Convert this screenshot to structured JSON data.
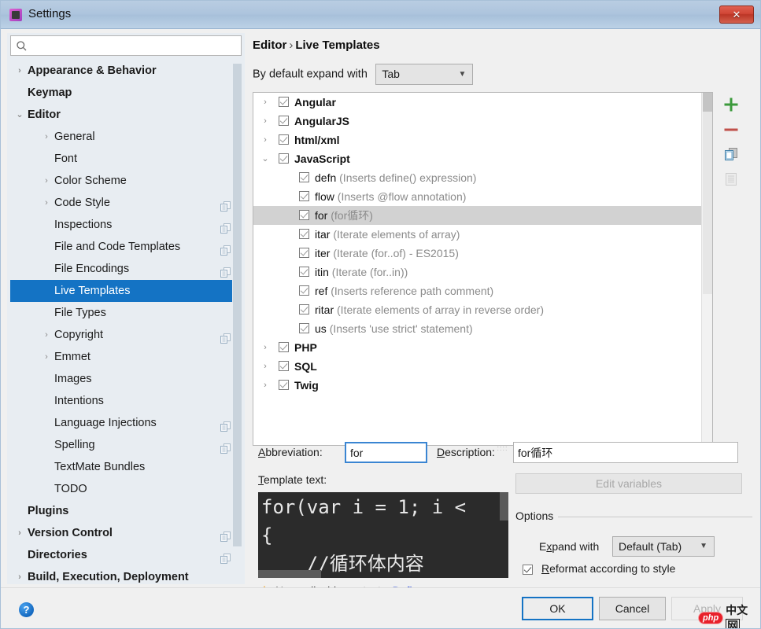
{
  "window": {
    "title": "Settings",
    "app_icon": "jetbrains-icon",
    "close_label": "✕"
  },
  "search": {
    "value": "",
    "placeholder": "",
    "icon": "search-icon"
  },
  "sidebar": {
    "items": [
      {
        "label": "Appearance & Behavior",
        "indent": 0,
        "arrow": "›",
        "bold": true,
        "copy": false,
        "selected": false
      },
      {
        "label": "Keymap",
        "indent": 0,
        "arrow": "",
        "bold": true,
        "copy": false,
        "selected": false
      },
      {
        "label": "Editor",
        "indent": 0,
        "arrow": "⌄",
        "bold": true,
        "copy": false,
        "selected": false
      },
      {
        "label": "General",
        "indent": 1,
        "arrow": "›",
        "bold": false,
        "copy": false,
        "selected": false
      },
      {
        "label": "Font",
        "indent": 1,
        "arrow": "",
        "bold": false,
        "copy": false,
        "selected": false
      },
      {
        "label": "Color Scheme",
        "indent": 1,
        "arrow": "›",
        "bold": false,
        "copy": false,
        "selected": false
      },
      {
        "label": "Code Style",
        "indent": 1,
        "arrow": "›",
        "bold": false,
        "copy": true,
        "selected": false
      },
      {
        "label": "Inspections",
        "indent": 1,
        "arrow": "",
        "bold": false,
        "copy": true,
        "selected": false
      },
      {
        "label": "File and Code Templates",
        "indent": 1,
        "arrow": "",
        "bold": false,
        "copy": true,
        "selected": false
      },
      {
        "label": "File Encodings",
        "indent": 1,
        "arrow": "",
        "bold": false,
        "copy": true,
        "selected": false
      },
      {
        "label": "Live Templates",
        "indent": 1,
        "arrow": "",
        "bold": false,
        "copy": false,
        "selected": true
      },
      {
        "label": "File Types",
        "indent": 1,
        "arrow": "",
        "bold": false,
        "copy": false,
        "selected": false
      },
      {
        "label": "Copyright",
        "indent": 1,
        "arrow": "›",
        "bold": false,
        "copy": true,
        "selected": false
      },
      {
        "label": "Emmet",
        "indent": 1,
        "arrow": "›",
        "bold": false,
        "copy": false,
        "selected": false
      },
      {
        "label": "Images",
        "indent": 1,
        "arrow": "",
        "bold": false,
        "copy": false,
        "selected": false
      },
      {
        "label": "Intentions",
        "indent": 1,
        "arrow": "",
        "bold": false,
        "copy": false,
        "selected": false
      },
      {
        "label": "Language Injections",
        "indent": 1,
        "arrow": "",
        "bold": false,
        "copy": true,
        "selected": false
      },
      {
        "label": "Spelling",
        "indent": 1,
        "arrow": "",
        "bold": false,
        "copy": true,
        "selected": false
      },
      {
        "label": "TextMate Bundles",
        "indent": 1,
        "arrow": "",
        "bold": false,
        "copy": false,
        "selected": false
      },
      {
        "label": "TODO",
        "indent": 1,
        "arrow": "",
        "bold": false,
        "copy": false,
        "selected": false
      },
      {
        "label": "Plugins",
        "indent": 0,
        "arrow": "",
        "bold": true,
        "copy": false,
        "selected": false
      },
      {
        "label": "Version Control",
        "indent": 0,
        "arrow": "›",
        "bold": true,
        "copy": true,
        "selected": false
      },
      {
        "label": "Directories",
        "indent": 0,
        "arrow": "",
        "bold": true,
        "copy": true,
        "selected": false
      },
      {
        "label": "Build, Execution, Deployment",
        "indent": 0,
        "arrow": "›",
        "bold": true,
        "copy": false,
        "selected": false
      }
    ]
  },
  "main": {
    "breadcrumb": {
      "root": "Editor",
      "separator": "›",
      "leaf": "Live Templates"
    },
    "expand_with": {
      "label": "By default expand with",
      "value": "Tab"
    },
    "templates": [
      {
        "name": "Angular",
        "desc": "",
        "indent": 0,
        "arrow": "›",
        "bold": true,
        "checked": true,
        "selected": false
      },
      {
        "name": "AngularJS",
        "desc": "",
        "indent": 0,
        "arrow": "›",
        "bold": true,
        "checked": true,
        "selected": false
      },
      {
        "name": "html/xml",
        "desc": "",
        "indent": 0,
        "arrow": "›",
        "bold": true,
        "checked": true,
        "selected": false
      },
      {
        "name": "JavaScript",
        "desc": "",
        "indent": 0,
        "arrow": "⌄",
        "bold": true,
        "checked": true,
        "selected": false
      },
      {
        "name": "defn",
        "desc": "(Inserts define() expression)",
        "indent": 1,
        "arrow": "",
        "bold": false,
        "checked": true,
        "selected": false
      },
      {
        "name": "flow",
        "desc": "(Inserts @flow annotation)",
        "indent": 1,
        "arrow": "",
        "bold": false,
        "checked": true,
        "selected": false
      },
      {
        "name": "for",
        "desc": "(for循环)",
        "indent": 1,
        "arrow": "",
        "bold": false,
        "checked": true,
        "selected": true
      },
      {
        "name": "itar",
        "desc": "(Iterate elements of array)",
        "indent": 1,
        "arrow": "",
        "bold": false,
        "checked": true,
        "selected": false
      },
      {
        "name": "iter",
        "desc": "(Iterate (for..of) - ES2015)",
        "indent": 1,
        "arrow": "",
        "bold": false,
        "checked": true,
        "selected": false
      },
      {
        "name": "itin",
        "desc": "(Iterate (for..in))",
        "indent": 1,
        "arrow": "",
        "bold": false,
        "checked": true,
        "selected": false
      },
      {
        "name": "ref",
        "desc": "(Inserts reference path comment)",
        "indent": 1,
        "arrow": "",
        "bold": false,
        "checked": true,
        "selected": false
      },
      {
        "name": "ritar",
        "desc": "(Iterate elements of array in reverse order)",
        "indent": 1,
        "arrow": "",
        "bold": false,
        "checked": true,
        "selected": false
      },
      {
        "name": "us",
        "desc": "(Inserts 'use strict' statement)",
        "indent": 1,
        "arrow": "",
        "bold": false,
        "checked": true,
        "selected": false
      },
      {
        "name": "PHP",
        "desc": "",
        "indent": 0,
        "arrow": "›",
        "bold": true,
        "checked": true,
        "selected": false
      },
      {
        "name": "SQL",
        "desc": "",
        "indent": 0,
        "arrow": "›",
        "bold": true,
        "checked": true,
        "selected": false
      },
      {
        "name": "Twig",
        "desc": "",
        "indent": 0,
        "arrow": "›",
        "bold": true,
        "checked": true,
        "selected": false
      }
    ],
    "toolbar": [
      {
        "name": "add-template-button",
        "icon": "plus-icon",
        "enabled": true
      },
      {
        "name": "remove-template-button",
        "icon": "minus-icon",
        "enabled": true
      },
      {
        "name": "duplicate-button",
        "icon": "copy-icon",
        "enabled": true
      },
      {
        "name": "copy-settings-button",
        "icon": "document-icon",
        "enabled": false
      }
    ],
    "form": {
      "abbreviation_label": "Abbreviation:",
      "abbreviation_accel": "A",
      "abbreviation_value": "for",
      "description_label": "Description:",
      "description_accel": "D",
      "description_value": "for循环",
      "template_text_label": "Template text:",
      "template_text_accel": "T",
      "template_code": "for(var i = 1; i <\n{\n    //循环体内容",
      "edit_variables_label": "Edit variables"
    },
    "options": {
      "title": "Options",
      "expand_with_label": "Expand with",
      "expand_with_accel": "x",
      "expand_with_value": "Default (Tab)",
      "reformat_label": "Reformat according to style",
      "reformat_accel": "R",
      "reformat_checked": true
    },
    "context_warning": {
      "icon": "warning-icon",
      "text": "No applicable contexts.",
      "link": "Define"
    }
  },
  "footer": {
    "help_label": "?",
    "ok_label": "OK",
    "cancel_label": "Cancel",
    "apply_label": "Apply",
    "apply_enabled": false
  },
  "watermark": {
    "badge": "php",
    "text": "中文",
    "boxed": "网"
  },
  "colors": {
    "accent": "#1473c4",
    "selection": "#1473c4",
    "row_selection": "#d2d2d2",
    "titlebar": "#adc4dd",
    "link": "#2b4ce0",
    "warning": "#f0ad3a",
    "add": "#3c9a3c",
    "remove": "#c0504a",
    "editor_bg": "#2b2b2b"
  }
}
